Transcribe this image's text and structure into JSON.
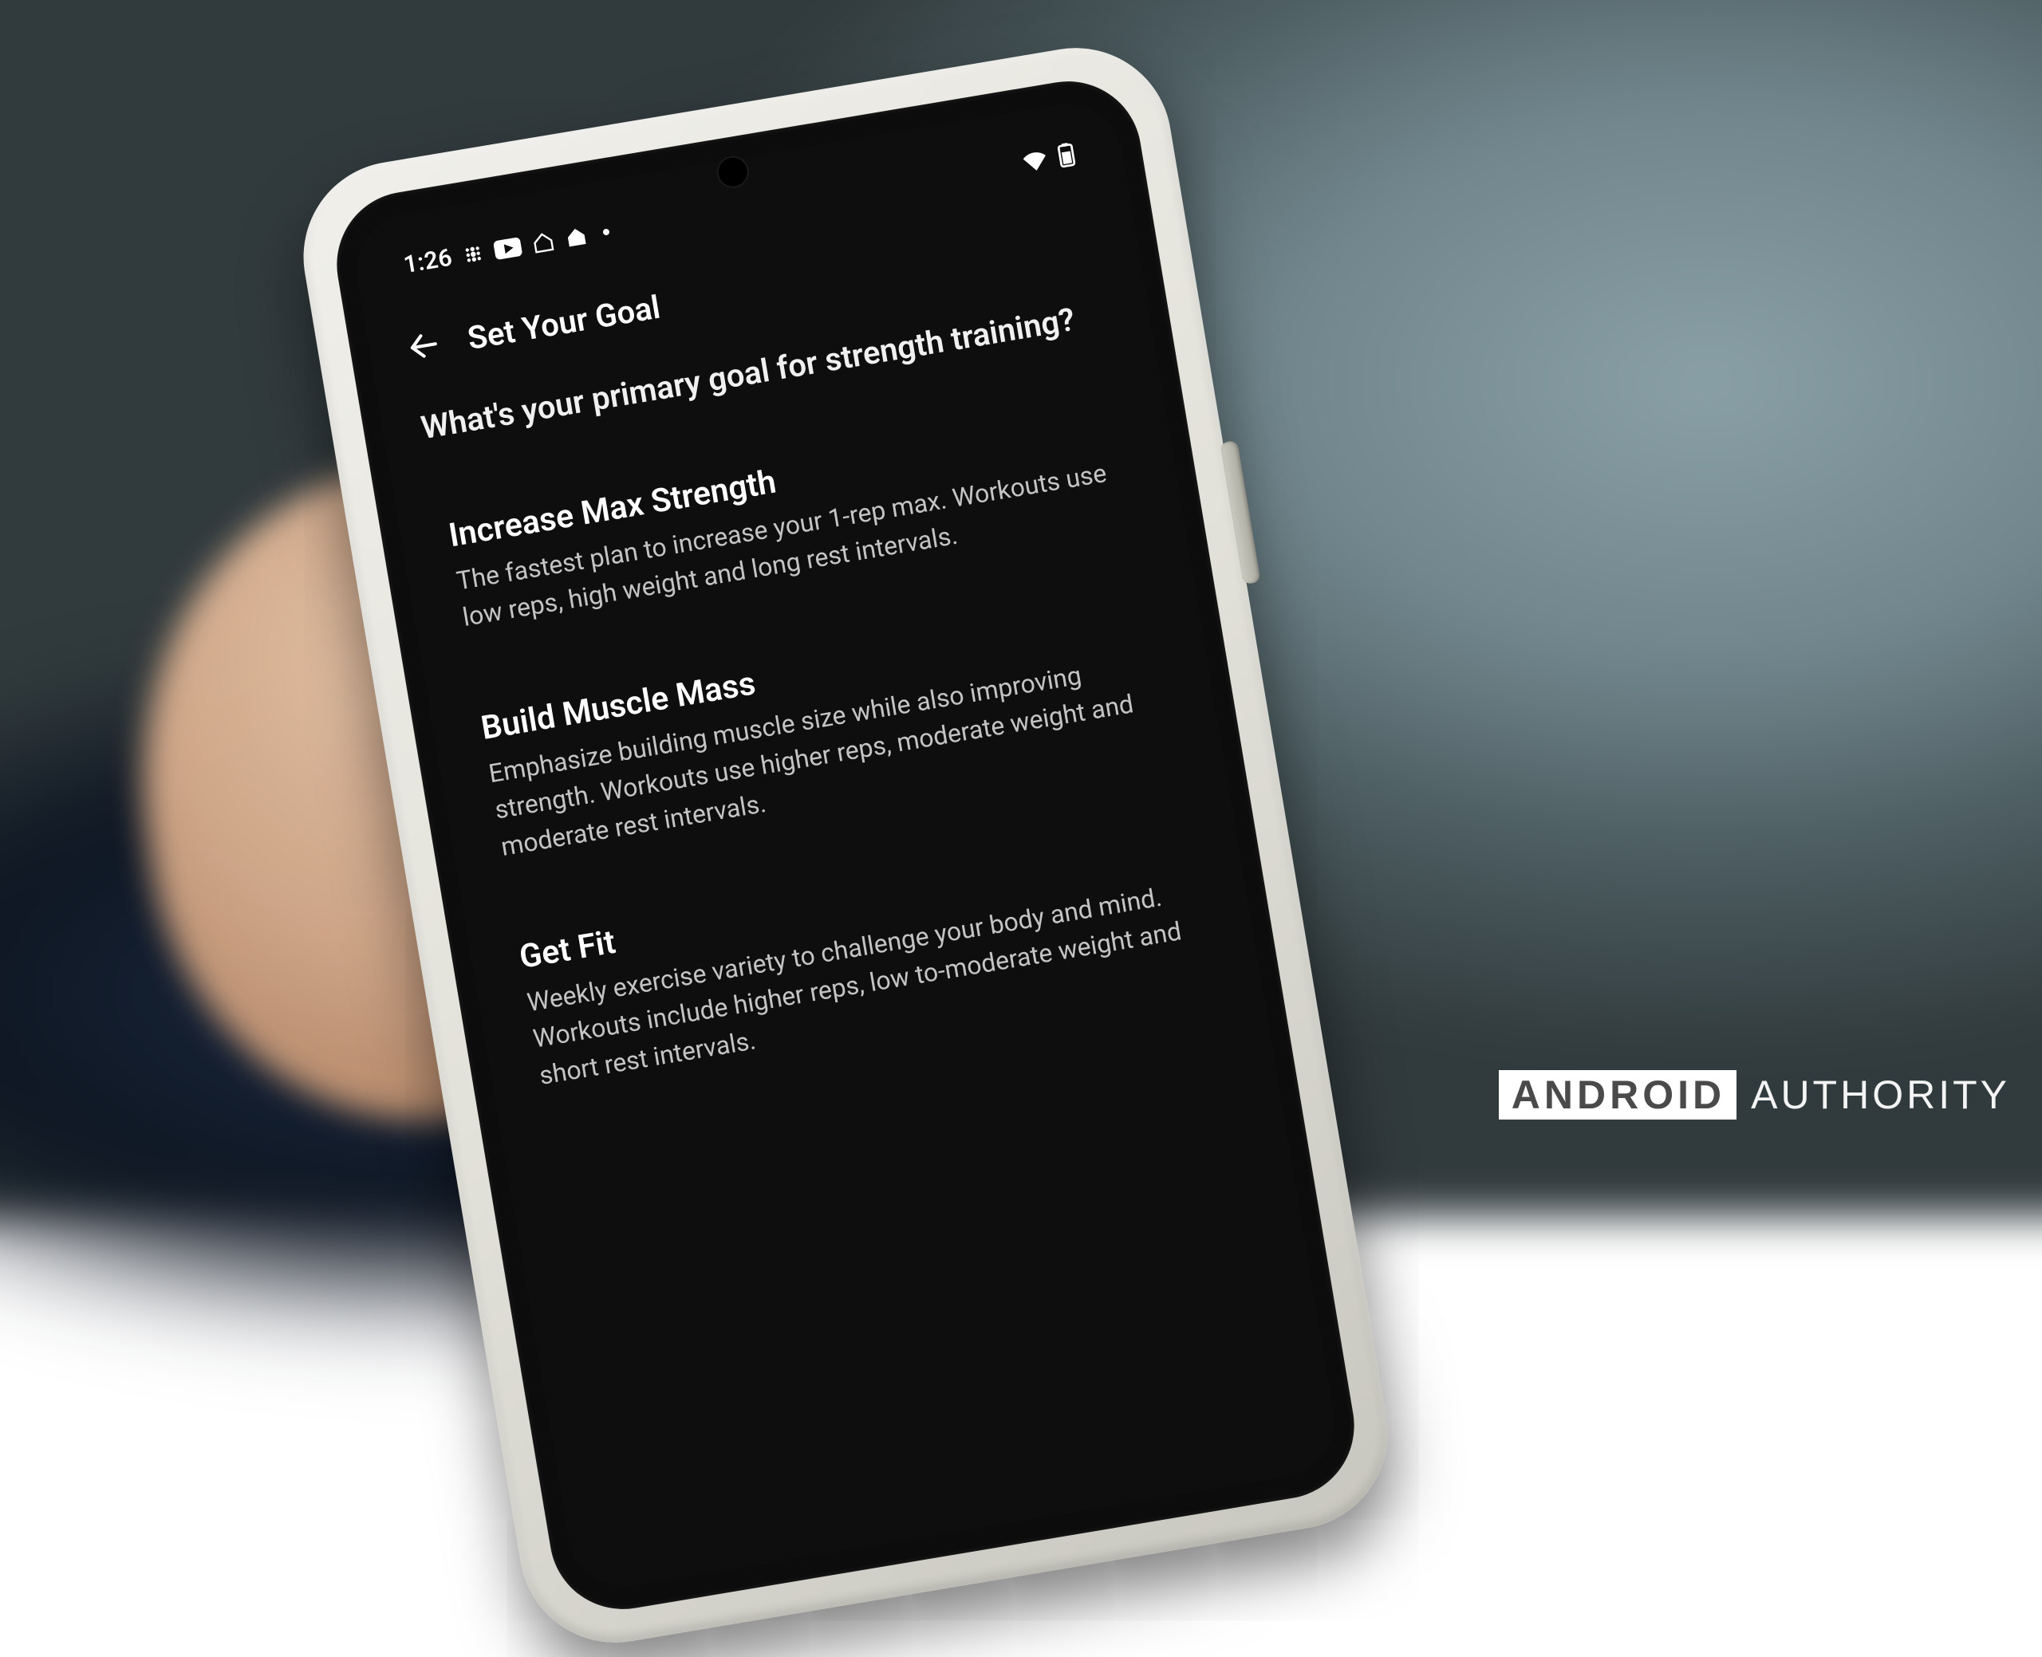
{
  "status": {
    "time": "1:26",
    "icons": [
      "fitbit-icon",
      "youtube-icon",
      "home-outline-icon",
      "home-icon"
    ],
    "right_icons": [
      "wifi-icon",
      "battery-icon"
    ]
  },
  "app_bar": {
    "title": "Set Your Goal"
  },
  "prompt": "What's your primary goal for strength training?",
  "options": [
    {
      "title": "Increase Max Strength",
      "desc": "The fastest plan to increase your 1-rep max. Workouts use low reps, high weight and long rest intervals."
    },
    {
      "title": "Build Muscle Mass",
      "desc": "Emphasize building muscle size while also improving strength. Workouts use higher reps, moderate weight and moderate rest intervals."
    },
    {
      "title": "Get Fit",
      "desc": "Weekly exercise variety to challenge your body and mind. Workouts include higher reps, low to-moderate weight and short rest intervals."
    }
  ],
  "watermark": {
    "brand_box": "ANDROID",
    "brand_rest": "AUTHORITY"
  }
}
